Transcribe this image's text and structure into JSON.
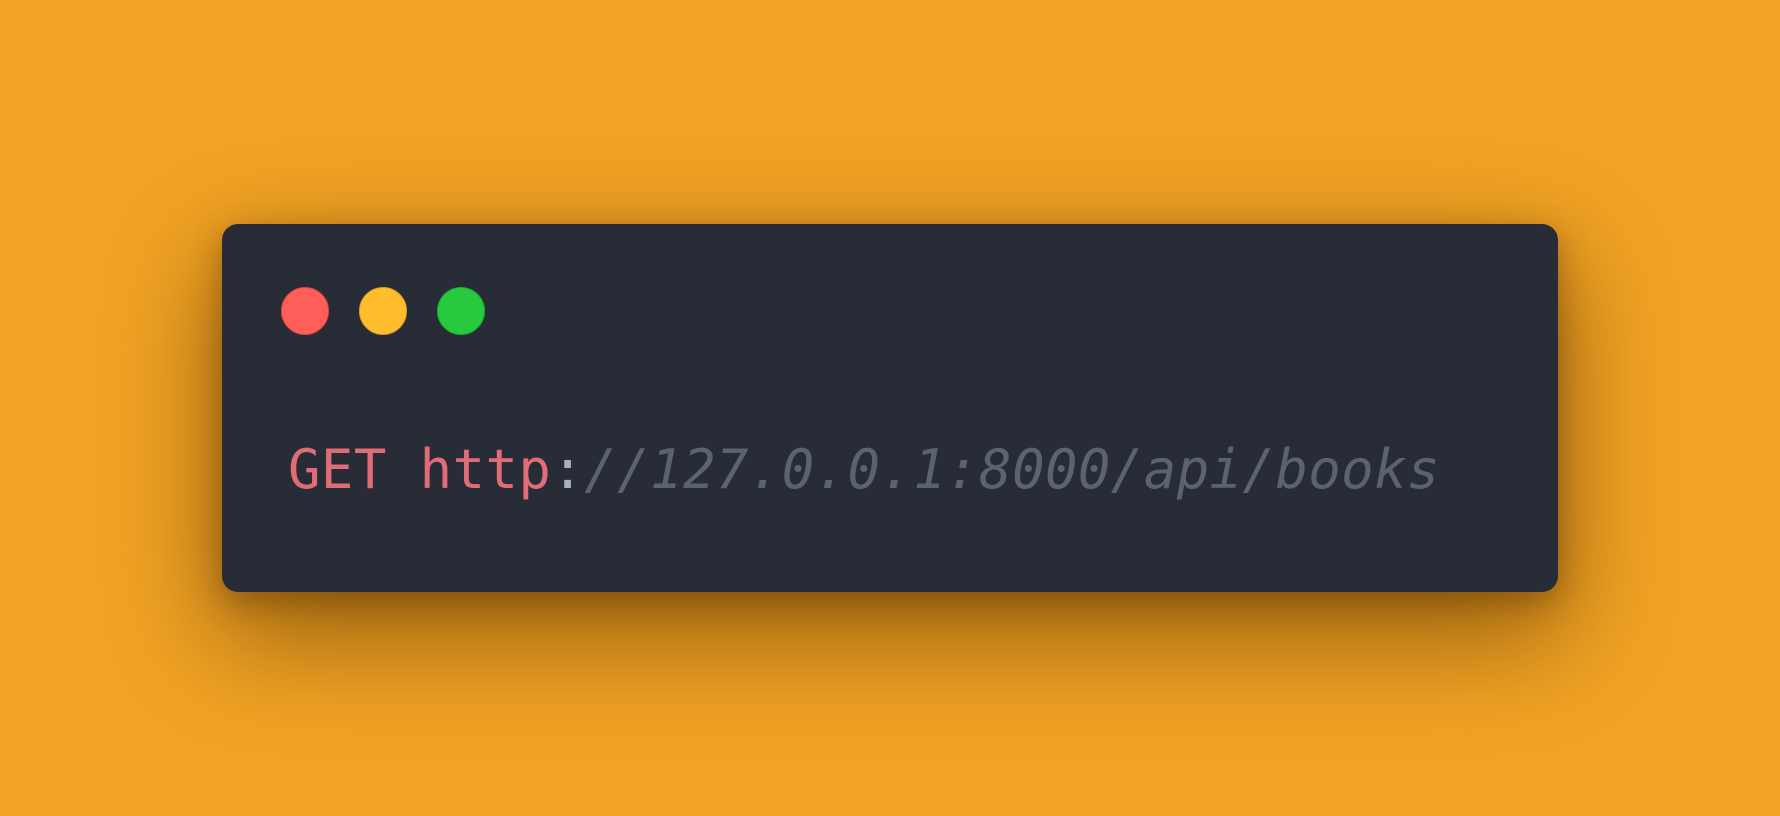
{
  "window": {
    "controls": [
      {
        "name": "close",
        "color": "#ff5f58"
      },
      {
        "name": "minimize",
        "color": "#ffbd2e"
      },
      {
        "name": "maximize",
        "color": "#27c93f"
      }
    ]
  },
  "code": {
    "method": "GET",
    "space": " ",
    "scheme": "http",
    "colon": ":",
    "rest": "//127.0.0.1:8000/api/books"
  },
  "colors": {
    "background": "#f3a424",
    "window": "#282c36",
    "keyword": "#e06c75",
    "punctuation": "#abb2bf",
    "comment": "#5c6370"
  }
}
